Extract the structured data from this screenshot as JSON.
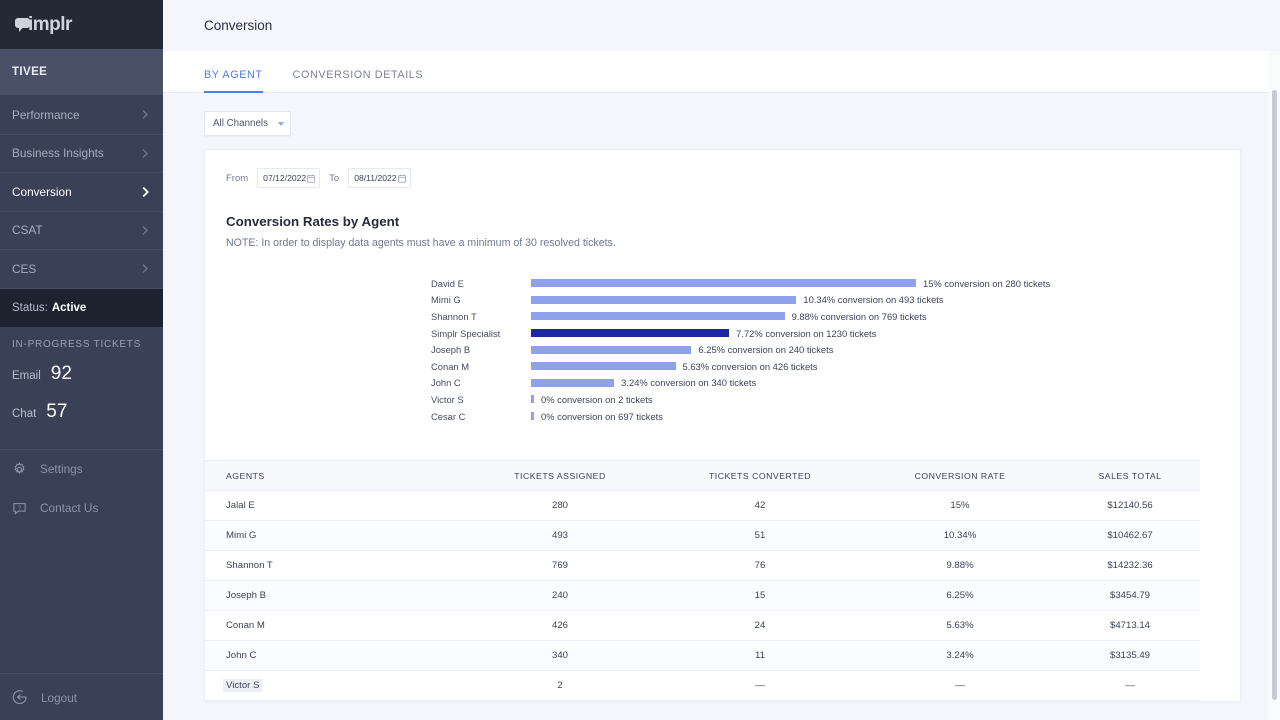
{
  "brand": {
    "logo_text": "implr",
    "logo_icon": "speech-bubble-logo-icon"
  },
  "sidebar": {
    "account": "TIVEE",
    "nav": [
      {
        "label": "Performance",
        "icon": "chevron-right-icon",
        "active": false
      },
      {
        "label": "Business Insights",
        "icon": "chevron-right-icon",
        "active": false
      },
      {
        "label": "Conversion",
        "icon": "chevron-right-icon",
        "active": true
      },
      {
        "label": "CSAT",
        "icon": "chevron-right-icon",
        "active": false
      },
      {
        "label": "CES",
        "icon": "chevron-right-icon",
        "active": false
      }
    ],
    "status_label": "Status:",
    "status_value": "Active",
    "tickets_section_label": "IN-PROGRESS TICKETS",
    "tickets": [
      {
        "label": "Email",
        "count": "92"
      },
      {
        "label": "Chat",
        "count": "57"
      }
    ],
    "utilities": [
      {
        "label": "Settings",
        "icon": "gear-icon"
      },
      {
        "label": "Contact Us",
        "icon": "chat-question-icon"
      }
    ],
    "logout": {
      "label": "Logout",
      "icon": "logout-icon"
    }
  },
  "header": {
    "title": "Conversion"
  },
  "tabs": [
    {
      "label": "BY AGENT",
      "active": true
    },
    {
      "label": "CONVERSION DETAILS",
      "active": false
    }
  ],
  "filters": {
    "channel_select": {
      "value": "All Channels",
      "icon": "chevron-down-icon"
    },
    "from_label": "From",
    "from_value": "07/12/2022",
    "to_label": "To",
    "to_value": "08/11/2022",
    "calendar_icon": "calendar-icon"
  },
  "card": {
    "heading": "Conversion Rates by Agent",
    "note": "NOTE: In order to display data agents must have a minimum of 30 resolved tickets."
  },
  "chart_data": {
    "type": "bar",
    "orientation": "horizontal",
    "title": "Conversion Rates by Agent",
    "xlabel": "",
    "ylabel": "",
    "grid": false,
    "legend": null,
    "value_unit": "% conversion",
    "xlim": [
      0,
      15
    ],
    "categories": [
      "David E",
      "Mimi G",
      "Shannon T",
      "Simplr Specialist",
      "Joseph B",
      "Conan M",
      "John C",
      "Victor S",
      "Cesar C"
    ],
    "values": [
      15,
      10.34,
      9.88,
      7.72,
      6.25,
      5.63,
      3.24,
      0,
      0
    ],
    "tickets": [
      280,
      493,
      769,
      1230,
      240,
      426,
      340,
      2,
      697
    ],
    "labels": [
      "15% conversion on 280 tickets",
      "10.34% conversion on 493 tickets",
      "9.88% conversion on 769 tickets",
      "7.72% conversion on 1230 tickets",
      "6.25% conversion on 240 tickets",
      "5.63% conversion on 426 tickets",
      "3.24% conversion on 340 tickets",
      "0% conversion on 2 tickets",
      "0% conversion on 697 tickets"
    ],
    "highlight_index": 3,
    "bar_color": "#8fa1ec",
    "highlight_color": "#1c2a9c"
  },
  "table": {
    "columns": [
      "AGENTS",
      "TICKETS ASSIGNED",
      "TICKETS CONVERTED",
      "CONVERSION RATE",
      "SALES TOTAL"
    ],
    "rows": [
      {
        "agent": "Jalal E",
        "assigned": "280",
        "converted": "42",
        "rate": "15%",
        "sales": "$12140.56"
      },
      {
        "agent": "Mimi G",
        "assigned": "493",
        "converted": "51",
        "rate": "10.34%",
        "sales": "$10462.67"
      },
      {
        "agent": "Shannon T",
        "assigned": "769",
        "converted": "76",
        "rate": "9.88%",
        "sales": "$14232.36"
      },
      {
        "agent": "Joseph B",
        "assigned": "240",
        "converted": "15",
        "rate": "6.25%",
        "sales": "$3454.79"
      },
      {
        "agent": "Conan M",
        "assigned": "426",
        "converted": "24",
        "rate": "5.63%",
        "sales": "$4713.14"
      },
      {
        "agent": "John C",
        "assigned": "340",
        "converted": "11",
        "rate": "3.24%",
        "sales": "$3135.49"
      },
      {
        "agent": "Victor S",
        "assigned": "2",
        "converted": "—",
        "rate": "—",
        "sales": "—"
      }
    ]
  },
  "colors": {
    "sidebar_bg": "#3a4055",
    "sidebar_dark": "#242936",
    "accent_blue": "#4a7ff0",
    "bar": "#8fa1ec",
    "bar_highlight": "#1c2a9c",
    "page_bg": "#f4f6fb"
  }
}
